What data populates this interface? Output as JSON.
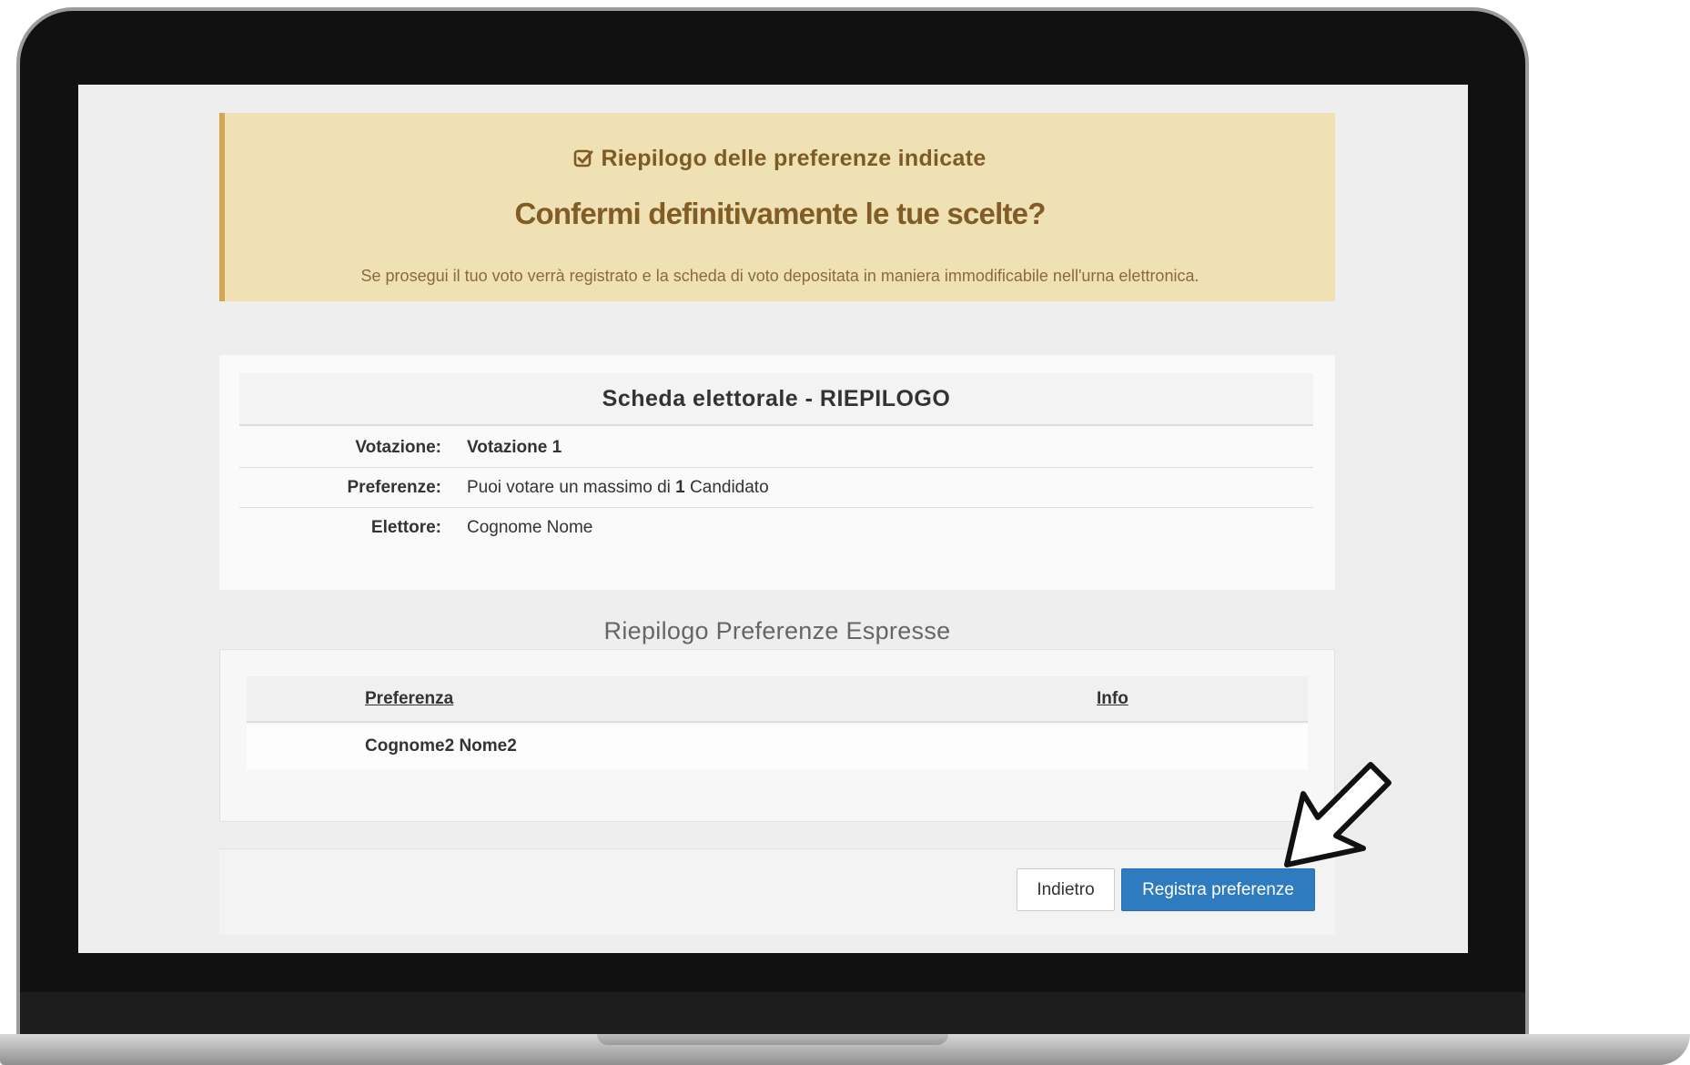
{
  "alert": {
    "icon": "check-square-icon",
    "heading": "Riepilogo delle preferenze indicate",
    "question": "Confermi definitivamente le tue scelte?",
    "text": "Se prosegui il tuo voto verrà registrato e la scheda di voto depositata in maniera immodificabile nell'urna elettronica."
  },
  "ballot": {
    "title": "Scheda elettorale - RIEPILOGO",
    "rows": [
      {
        "label": "Votazione:",
        "value": "Votazione 1"
      },
      {
        "label": "Preferenze:",
        "value_prefix": "Puoi votare un massimo di ",
        "value_number": "1",
        "value_suffix": " Candidato"
      },
      {
        "label": "Elettore:",
        "value": "Cognome Nome"
      }
    ]
  },
  "summary": {
    "heading": "Riepilogo Preferenze Espresse",
    "columns": [
      "Preferenza",
      "Info"
    ],
    "rows": [
      {
        "preferenza": "Cognome2 Nome2",
        "info": ""
      }
    ]
  },
  "footer": {
    "back_label": "Indietro",
    "submit_label": "Registra preferenze"
  },
  "colors": {
    "alert_bg": "#f0e1b4",
    "alert_border": "#d6a552",
    "alert_text": "#7d5b27",
    "primary_button": "#2f7bbf"
  }
}
